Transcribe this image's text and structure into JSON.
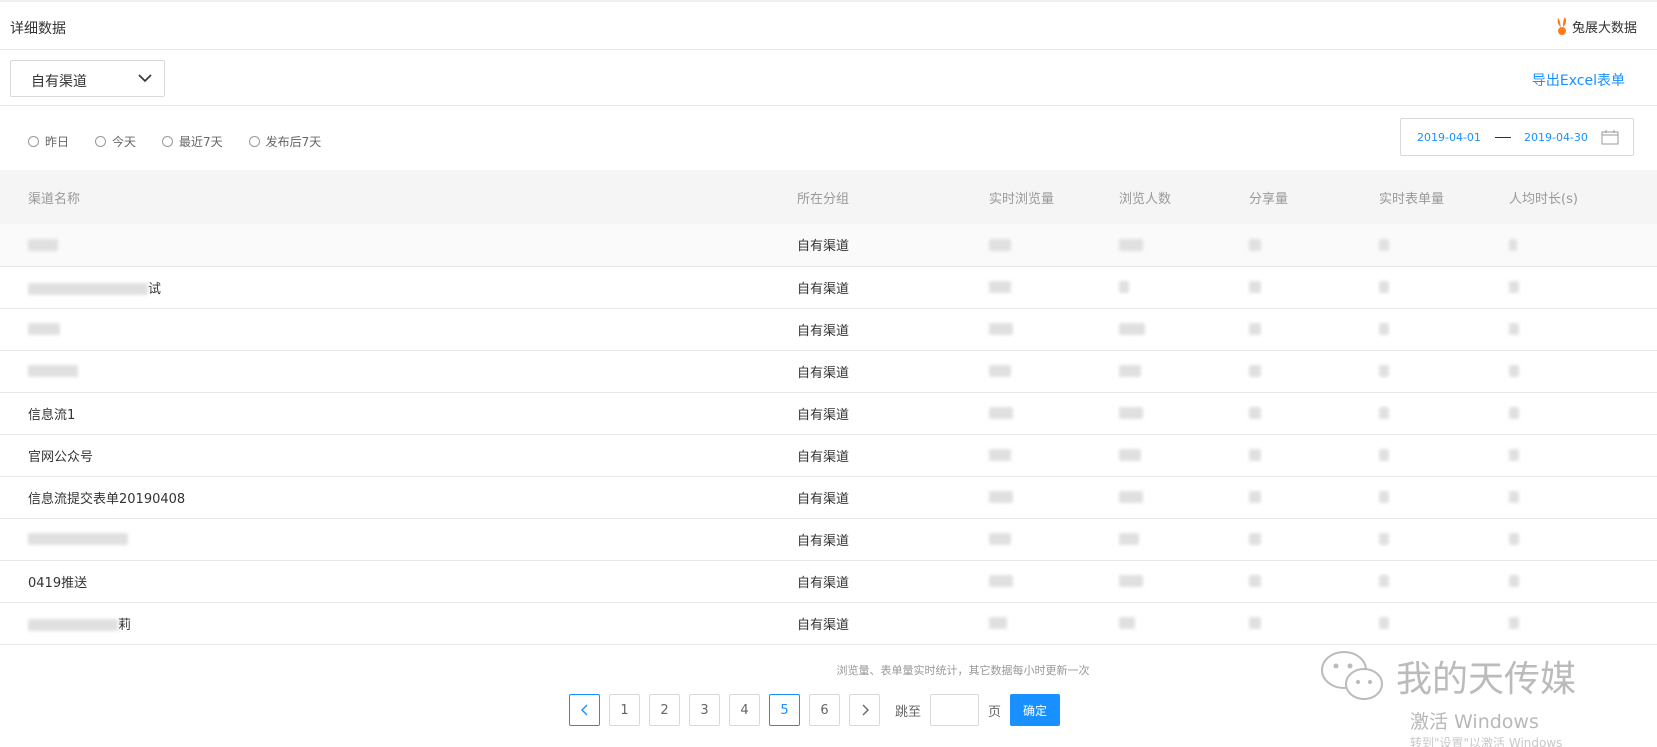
{
  "header": {
    "title": "详细数据",
    "brand": "兔展大数据"
  },
  "filter": {
    "channel_select": "自有渠道",
    "export_label": "导出Excel表单"
  },
  "date": {
    "options": [
      "昨日",
      "今天",
      "最近7天",
      "发布后7天"
    ],
    "start": "2019-04-01",
    "end": "2019-04-30"
  },
  "table": {
    "columns": [
      "渠道名称",
      "所在分组",
      "实时浏览量",
      "浏览人数",
      "分享量",
      "实时表单量",
      "人均时长(s)"
    ],
    "rows": [
      {
        "name": "",
        "group": "自有渠道"
      },
      {
        "name": "试",
        "group": "自有渠道"
      },
      {
        "name": "",
        "group": "自有渠道"
      },
      {
        "name": "",
        "group": "自有渠道"
      },
      {
        "name": "信息流1",
        "group": "自有渠道"
      },
      {
        "name": "官网公众号",
        "group": "自有渠道"
      },
      {
        "name": "信息流提交表单20190408",
        "group": "自有渠道"
      },
      {
        "name": "",
        "group": "自有渠道"
      },
      {
        "name": "0419推送",
        "group": "自有渠道"
      },
      {
        "name": "莉",
        "group": "自有渠道"
      }
    ]
  },
  "footer": {
    "note": "浏览量、表单量实时统计，其它数据每小时更新一次",
    "pages": [
      "1",
      "2",
      "3",
      "4",
      "5",
      "6"
    ],
    "active_page": "5",
    "jump_label": "跳至",
    "page_label": "页",
    "confirm_label": "确定"
  },
  "overlay": {
    "watermark_text": "我的天传媒",
    "windows_activate": "激活 Windows",
    "windows_hint": "转到\"设置\"以激活 Windows"
  },
  "colors": {
    "accent": "#1890ff",
    "brand": "#ff7a1a"
  },
  "icons": [
    "chevron-down-icon",
    "calendar-icon",
    "chevron-left-icon",
    "chevron-right-icon",
    "wechat-icon",
    "rabbit-logo-icon"
  ]
}
